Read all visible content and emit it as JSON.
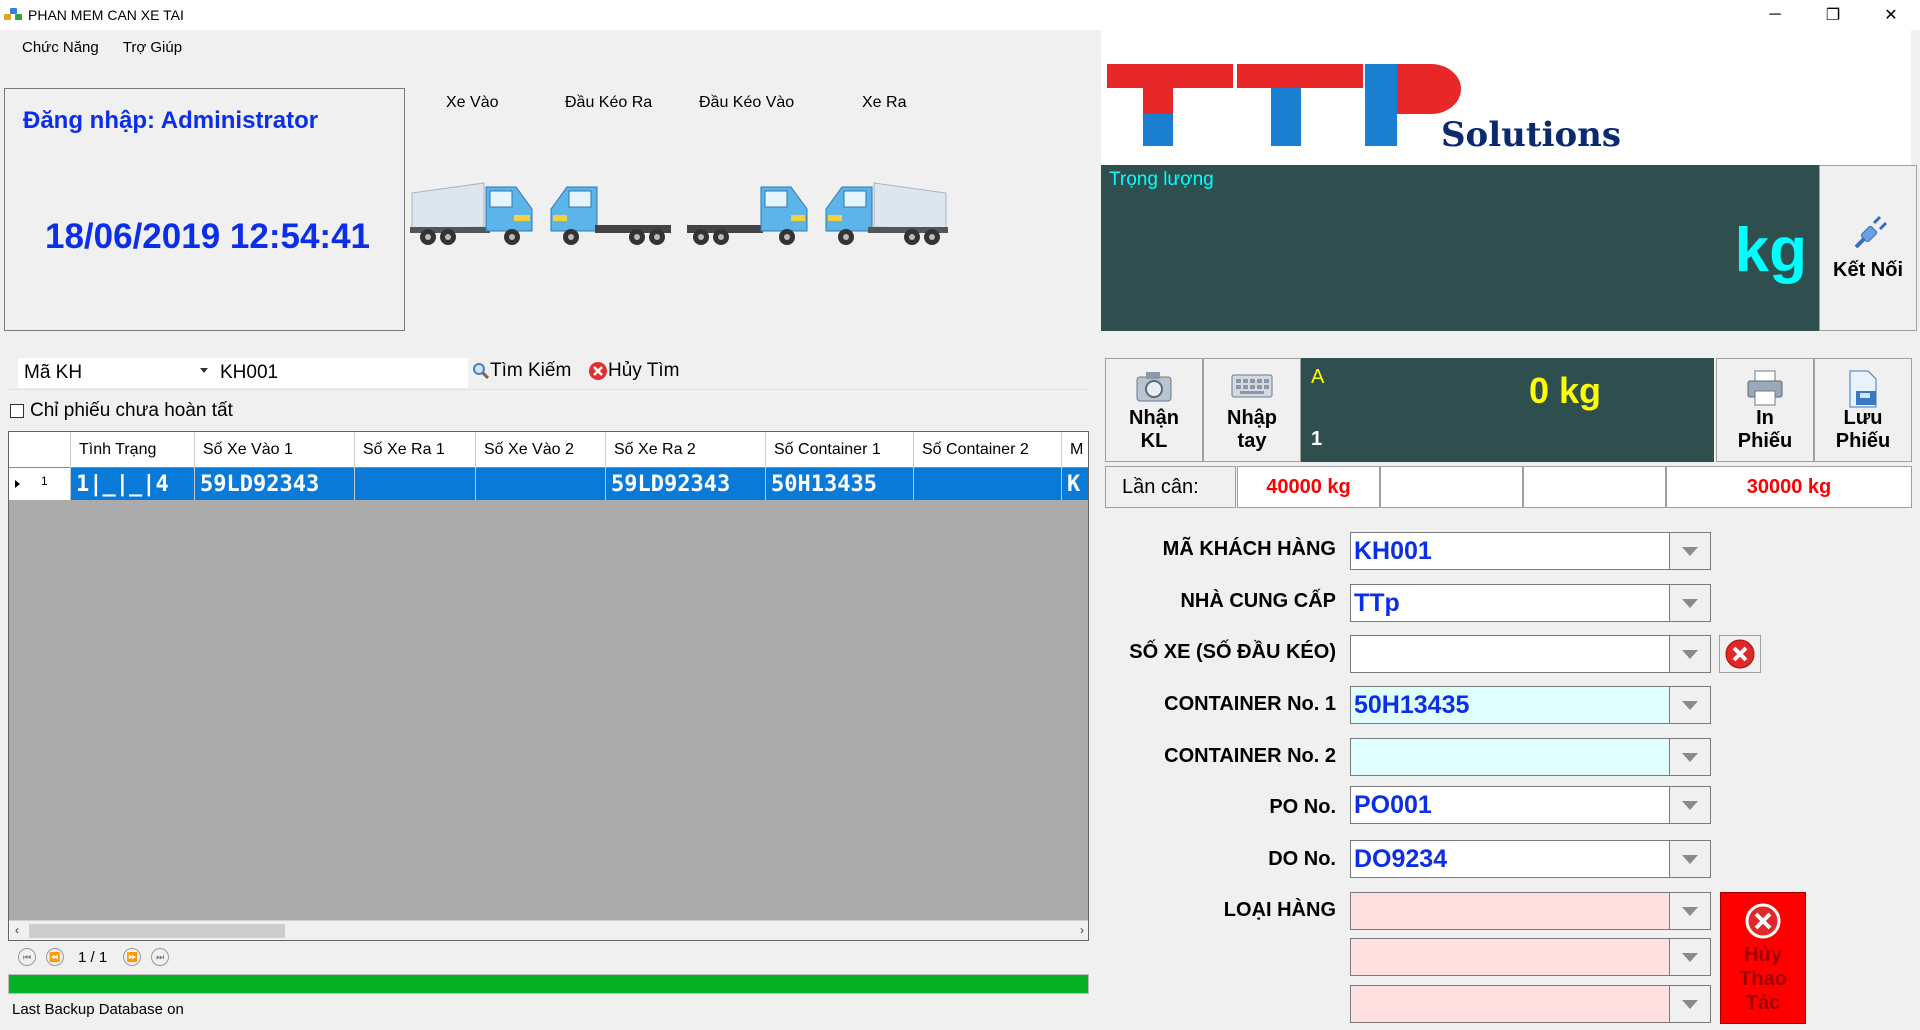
{
  "window": {
    "title": "PHAN MEM CAN XE TAI",
    "minimize": "─",
    "restore": "❐",
    "close": "✕"
  },
  "menu": {
    "items": [
      "Chức Năng",
      "Trợ Giúp"
    ]
  },
  "login": {
    "label": "Đăng nhập: Administrator",
    "datetime": "18/06/2019 12:54:41"
  },
  "modes": {
    "truck_in": "Xe Vào",
    "tractor_out": "Đầu Kéo Ra",
    "tractor_in": "Đầu Kéo Vào",
    "truck_out": "Xe Ra"
  },
  "logo": {
    "letters": "TTP",
    "tagline": "Solutions"
  },
  "weight_display": {
    "title": "Trọng lượng",
    "unit": "kg"
  },
  "connect_button": {
    "label": "Kết Nối"
  },
  "search": {
    "field": "Mã KH",
    "value": "KH001",
    "search_label": "Tìm Kiếm",
    "cancel_label": "Hủy Tìm",
    "checkbox_label": "Chỉ phiếu chưa hoàn tất"
  },
  "grid": {
    "columns": [
      "Tình Trạng",
      "Số Xe Vào 1",
      "Số Xe Ra 1",
      "Số Xe Vào 2",
      "Số Xe Ra 2",
      "Số Container 1",
      "Số Container 2",
      "M"
    ],
    "rows": [
      {
        "index": "1",
        "cells": [
          "1|_|_|4",
          "59LD92343",
          "",
          "",
          "59LD92343",
          "50H13435",
          "",
          "K"
        ]
      }
    ]
  },
  "pager": {
    "text": "1 / 1"
  },
  "progress": {
    "fraction": 1.0
  },
  "status": {
    "text": "Last Backup Database on"
  },
  "toolbar": {
    "get_weight": "Nhận\nKL",
    "manual_entry": "Nhập\ntay",
    "print": "In\nPhiếu",
    "save": "Lưu\nPhiếu"
  },
  "mini_display": {
    "channel": "A",
    "index": "1",
    "weight": "0 kg"
  },
  "weighings": {
    "label": "Lần cân:",
    "values": [
      "40000 kg",
      "",
      "",
      "30000 kg"
    ]
  },
  "form": {
    "customer_code": {
      "label": "MÃ KHÁCH HÀNG",
      "value": "KH001"
    },
    "supplier": {
      "label": "NHÀ CUNG CẤP",
      "value": "TTp"
    },
    "vehicle_no": {
      "label": "SỐ XE (SỐ ĐẦU KÉO)",
      "value": ""
    },
    "container1": {
      "label": "CONTAINER No. 1",
      "value": "50H13435"
    },
    "container2": {
      "label": "CONTAINER No. 2",
      "value": ""
    },
    "po_no": {
      "label": "PO No.",
      "value": "PO001"
    },
    "do_no": {
      "label": "DO No.",
      "value": "DO9234"
    },
    "goods_type": {
      "label": "LOẠI HÀNG",
      "values": [
        "",
        "",
        ""
      ]
    }
  },
  "cancel_operation": {
    "label": "Hủy\nThao\nTác"
  },
  "colors": {
    "display_bg": "#2f4f4f",
    "cyan_text": "#00ffff",
    "yellow_text": "#ffff00",
    "blue_text": "#0b2ee8",
    "selection": "#0a7ad8",
    "logo_red": "#e82828",
    "logo_blue": "#1a7fd0",
    "alert_red": "#ff0000",
    "progress_green": "#06b025"
  }
}
